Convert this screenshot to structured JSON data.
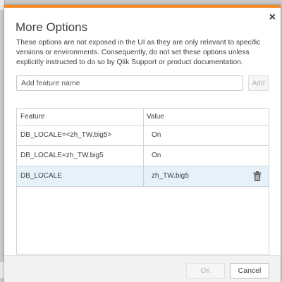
{
  "dialog": {
    "title": "More Options",
    "close_glyph": "×",
    "description": "These options are not exposed in the UI as they are only relevant to specific versions or environments. Consequently, do not set these options unless explicitly instructed to do so by Qlik Support or product documentation.",
    "accent_color": "#f8861f"
  },
  "add_feature": {
    "placeholder": "Add feature name",
    "value": "",
    "add_label": "Add"
  },
  "table": {
    "columns": [
      "Feature",
      "Value"
    ],
    "rows": [
      {
        "feature": "DB_LOCALE=<zh_TW.big5>",
        "value": "On",
        "selected": false
      },
      {
        "feature": "DB_LOCALE=zh_TW.big5",
        "value": "On",
        "selected": false
      },
      {
        "feature": "DB_LOCALE",
        "value": "zh_TW.big5",
        "selected": true
      }
    ],
    "selected_row_color": "#e5f2fa",
    "row_action_icon": "trash-icon"
  },
  "footer": {
    "ok_label": "OK",
    "cancel_label": "Cancel"
  }
}
